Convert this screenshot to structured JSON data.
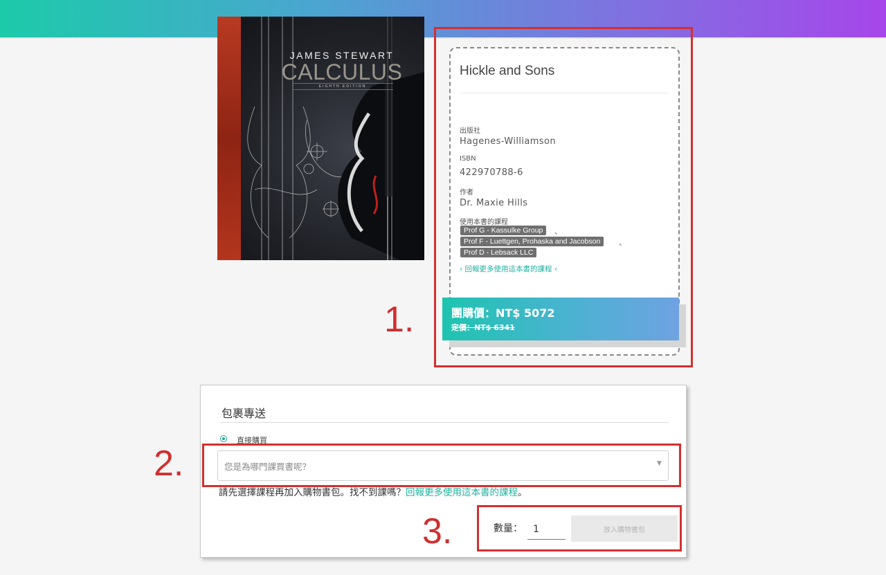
{
  "book": {
    "cover": {
      "author": "JAMES STEWART",
      "title": "CALCULUS",
      "edition": "EIGHTH EDITION"
    },
    "title": "Hickle and Sons",
    "publisher_label": "出版社",
    "publisher": "Hagenes-Williamson",
    "isbn_label": "ISBN",
    "isbn": "422970788-6",
    "author_label": "作者",
    "author": "Dr. Maxie Hills",
    "courses_label": "使用本書的課程",
    "courses": [
      "Prof G - Kassulke Group",
      "Prof F - Luettgen, Prohaska and Jacobson",
      "Prof D - Lebsack LLC"
    ],
    "course_separator": "、",
    "report_link": "› 回報更多使用這本書的課程 ‹",
    "group_price": "團購價：NT$ 5072",
    "list_price": "定價：NT$ 6341"
  },
  "annotations": [
    "1.",
    "2.",
    "3."
  ],
  "delivery": {
    "heading": "包裹專送",
    "option_label": "直接購買",
    "select_placeholder": "您是為哪門課買書呢？",
    "note_text": "請先選擇課程再加入購物書包。找不到課嗎？",
    "note_link": "回報更多使用這本書的課程",
    "note_end": "。",
    "quantity_label": "數量：",
    "quantity_value": "1",
    "add_button": "放入購物書包"
  },
  "colors": {
    "accent": "#1fb3a0",
    "annotation_red": "#d52f2f",
    "gradient_start": "#1ccaa9",
    "gradient_end": "#a646ea"
  }
}
